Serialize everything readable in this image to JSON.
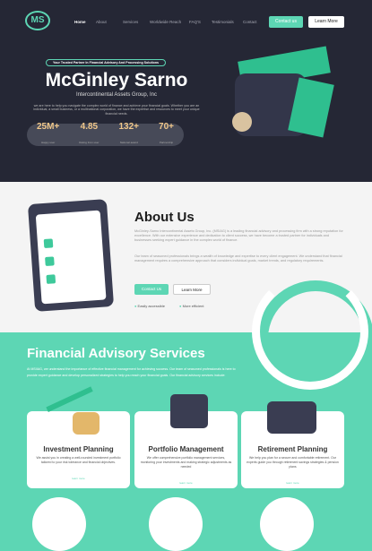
{
  "logo": "MS",
  "nav": [
    "Home",
    "About",
    "Services",
    "Worldwide Reach",
    "FAQ'S",
    "Testimonials",
    "Contact"
  ],
  "header_buttons": {
    "contact": "Contact us",
    "learn": "Learn More"
  },
  "hero": {
    "badge": "Your Trusted Partner In Financial Advisory And Processing Solutions",
    "title": "McGinley Sarno",
    "subtitle": "Intercontinental Assets Group, Inc",
    "text": "we are here to help you navigate the complex world of finance and achieve your financial goals. Whether you are an individual, a small business, or a multinational corporation, we have the expertise and resources to meet your unique financial needs.",
    "stats": [
      {
        "value": "25M+",
        "label": "Happy user"
      },
      {
        "value": "4.85",
        "label": "Rating from user"
      },
      {
        "value": "132+",
        "label": "National award"
      },
      {
        "value": "70+",
        "label": "Partnership"
      }
    ]
  },
  "about": {
    "title": "About Us",
    "p1": "McGinley-Sarno Intercontinental Assets Group, Inc. (MSIAG) is a leading financial advisory and processing firm with a strong reputation for excellence. With our extensive experience and dedication to client success, we have become a trusted partner for individuals and businesses seeking expert guidance in the complex world of finance.",
    "p2": "Our team of seasoned professionals brings a wealth of knowledge and expertise to every client engagement. We understand that financial management requires a comprehensive approach that considers individual goals, market trends, and regulatory requirements.",
    "contact": "Contact Us",
    "learn": "Learn More",
    "checks": [
      "Easily accessible",
      "More efficient"
    ]
  },
  "services": {
    "title": "Financial Advisory Services",
    "text": "At MSIIAG, we understand the importance of effective financial management for achieving success. Our team of seasoned professionals is here to provide expert guidance and develop personalized strategies to help you reach your financial goals. Our financial advisory services include:",
    "cards": [
      {
        "title": "Investment Planning",
        "text": "We assist you in creating a well-rounded investment portfolio tailored to your risk tolerance and financial objectives.",
        "link": "learn more"
      },
      {
        "title": "Portfolio Management",
        "text": "We offer comprehensive portfolio management services, monitoring your investments and making strategic adjustments as needed",
        "link": "learn more"
      },
      {
        "title": "Retirement Planning",
        "text": "We help you plan for a secure and comfortable retirement. Our experts guide you through retirement savings strategies & pension plans",
        "link": "learn more"
      }
    ]
  },
  "colors": {
    "accent": "#5dd6b4",
    "dark": "#252735"
  }
}
